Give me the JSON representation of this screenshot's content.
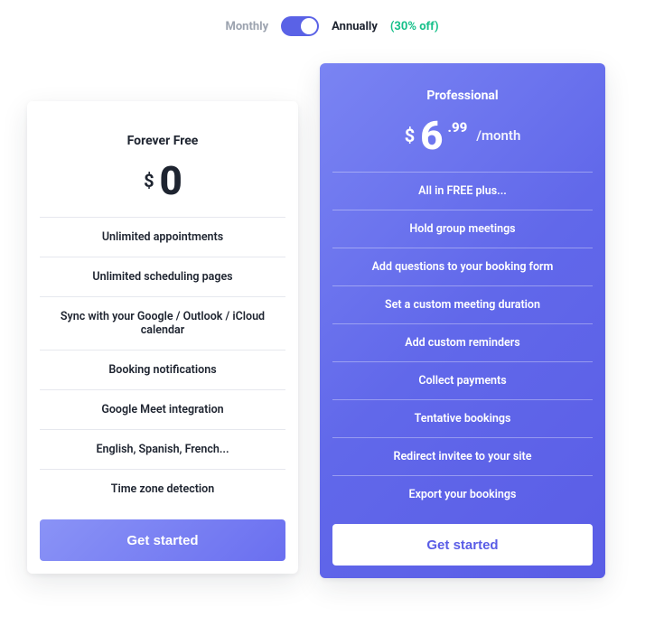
{
  "billing": {
    "monthly_label": "Monthly",
    "annually_label": "Annually",
    "discount_label": "(30% off)",
    "active": "annually"
  },
  "plans": {
    "free": {
      "title": "Forever Free",
      "currency": "$",
      "price_main": "0",
      "features": [
        "Unlimited appointments",
        "Unlimited scheduling pages",
        "Sync with your Google / Outlook / iCloud calendar",
        "Booking notifications",
        "Google Meet integration",
        "English, Spanish, French...",
        "Time zone detection"
      ],
      "cta_label": "Get started"
    },
    "pro": {
      "title": "Professional",
      "currency": "$",
      "price_main": "6",
      "price_cents": ".99",
      "price_period": "/month",
      "features": [
        "All in FREE plus...",
        "Hold group meetings",
        "Add questions to your booking form",
        "Set a custom meeting duration",
        "Add custom reminders",
        "Collect payments",
        "Tentative bookings",
        "Redirect invitee to your site",
        "Export your bookings"
      ],
      "cta_label": "Get started"
    }
  }
}
